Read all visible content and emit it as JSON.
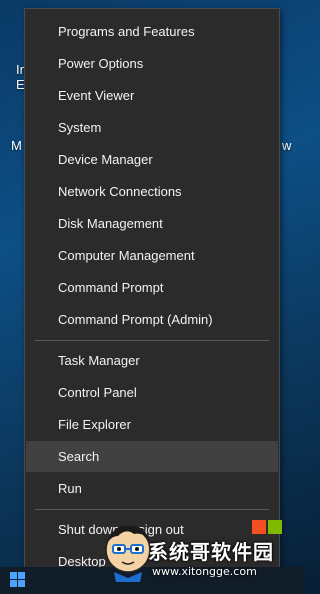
{
  "desktop": {
    "fragments": [
      {
        "text": "In"
      },
      {
        "text": "E"
      },
      {
        "text": "M"
      },
      {
        "text": "w"
      }
    ]
  },
  "menu": {
    "items": [
      {
        "label": "Programs and Features"
      },
      {
        "label": "Power Options"
      },
      {
        "label": "Event Viewer"
      },
      {
        "label": "System"
      },
      {
        "label": "Device Manager"
      },
      {
        "label": "Network Connections"
      },
      {
        "label": "Disk Management"
      },
      {
        "label": "Computer Management"
      },
      {
        "label": "Command Prompt"
      },
      {
        "label": "Command Prompt (Admin)"
      },
      {
        "label": "Task Manager"
      },
      {
        "label": "Control Panel"
      },
      {
        "label": "File Explorer"
      },
      {
        "label": "Search"
      },
      {
        "label": "Run"
      },
      {
        "label": "Shut down or sign out"
      },
      {
        "label": "Desktop"
      }
    ],
    "highlighted": "Search"
  },
  "watermark": {
    "site_name": "系统哥软件园",
    "url": "www.xitongge.com"
  },
  "colors": {
    "menu_bg": "#2b2b2b",
    "hover_bg": "#414141",
    "text": "#f2f2f2",
    "start_blue": "#4aa3ff"
  },
  "icons": {
    "start": "windows-logo-icon",
    "brand": "cartoon-mascot-icon"
  }
}
